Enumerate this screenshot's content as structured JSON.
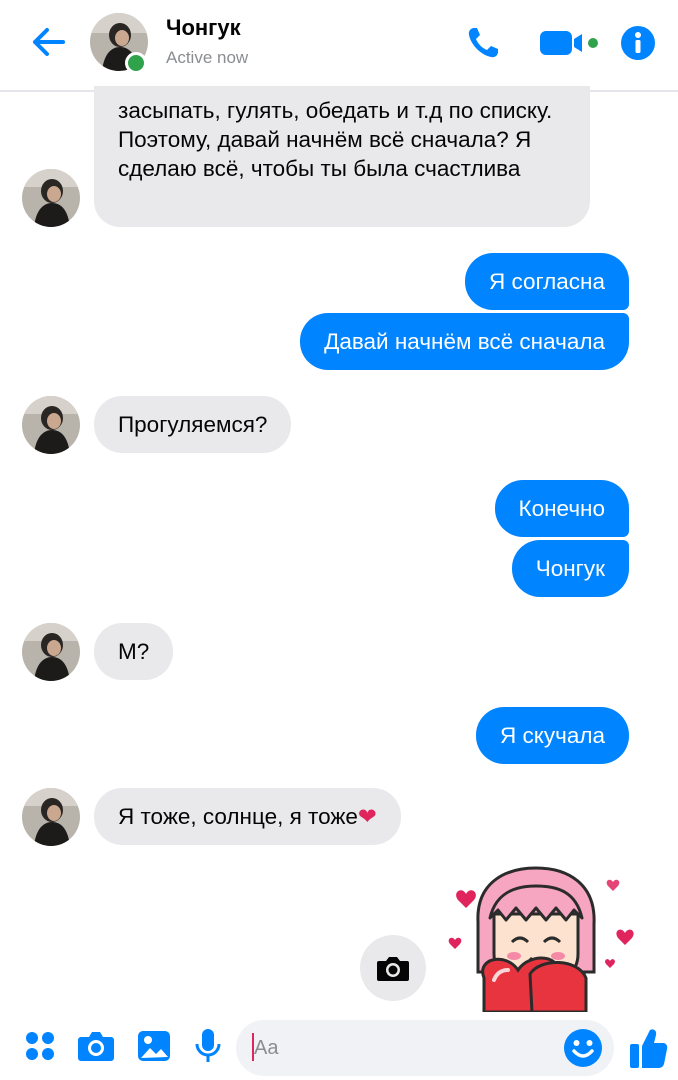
{
  "header": {
    "contact_name": "Чонгук",
    "status": "Active now"
  },
  "messages": [
    {
      "side": "incoming",
      "text": "засыпать, гулять, обедать и т.д по списку. Поэтому, давай начнём всё сначала? Я сделаю всё, чтобы ты была счастлива"
    },
    {
      "side": "outgoing",
      "text": "Я согласна"
    },
    {
      "side": "outgoing",
      "text": "Давай начнём всё сначала"
    },
    {
      "side": "incoming",
      "text": "Прогуляемся?"
    },
    {
      "side": "outgoing",
      "text": "Конечно"
    },
    {
      "side": "outgoing",
      "text": "Чонгук"
    },
    {
      "side": "incoming",
      "text": "М?"
    },
    {
      "side": "outgoing",
      "text": "Я скучала"
    },
    {
      "side": "incoming",
      "text": "Я тоже, солнце, я тоже",
      "emoji": "❤"
    }
  ],
  "composer": {
    "placeholder": "Aa",
    "value": ""
  },
  "colors": {
    "accent": "#0084ff",
    "incoming_bubble": "#e9e9eb",
    "online": "#31a24c",
    "heart": "#e0245e"
  },
  "icons": {
    "header": [
      "back-arrow-icon",
      "phone-icon",
      "video-camera-icon",
      "info-icon"
    ],
    "toolbar": [
      "apps-grid-icon",
      "camera-icon",
      "gallery-icon",
      "microphone-icon",
      "emoji-icon",
      "thumbs-up-icon"
    ]
  }
}
